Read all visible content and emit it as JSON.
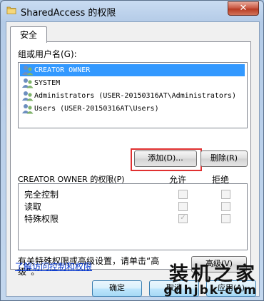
{
  "window": {
    "title": "SharedAccess 的权限",
    "close_glyph": "✕"
  },
  "tabs": [
    {
      "label": "安全"
    }
  ],
  "groups": {
    "label": "组或用户名(G):",
    "items": [
      {
        "name": "CREATOR OWNER",
        "selected": true
      },
      {
        "name": "SYSTEM",
        "selected": false
      },
      {
        "name": "Administrators (USER-20150316AT\\Administrators)",
        "selected": false
      },
      {
        "name": "Users (USER-20150316AT\\Users)",
        "selected": false
      }
    ],
    "add_label": "添加(D)...",
    "remove_label": "删除(R)"
  },
  "permissions": {
    "title": "CREATOR OWNER 的权限(P)",
    "allow_header": "允许",
    "deny_header": "拒绝",
    "rows": [
      {
        "name": "完全控制",
        "allow": false,
        "deny": false
      },
      {
        "name": "读取",
        "allow": false,
        "deny": false
      },
      {
        "name": "特殊权限",
        "allow": true,
        "deny": false
      }
    ]
  },
  "advanced": {
    "text_line1": "有关特殊权限或高级设置，请单击“高",
    "text_line2": "级”。",
    "button_label": "高级(V)"
  },
  "learn_link": "了解访问控制和权限",
  "buttons": {
    "ok": "确定",
    "cancel": "取消",
    "apply": "应用(A)"
  },
  "watermark": {
    "main": "装机之家",
    "url": "gdhjbk.com"
  },
  "colors": {
    "selection": "#3399ff",
    "highlight": "#e03030",
    "link": "#0033cc"
  }
}
